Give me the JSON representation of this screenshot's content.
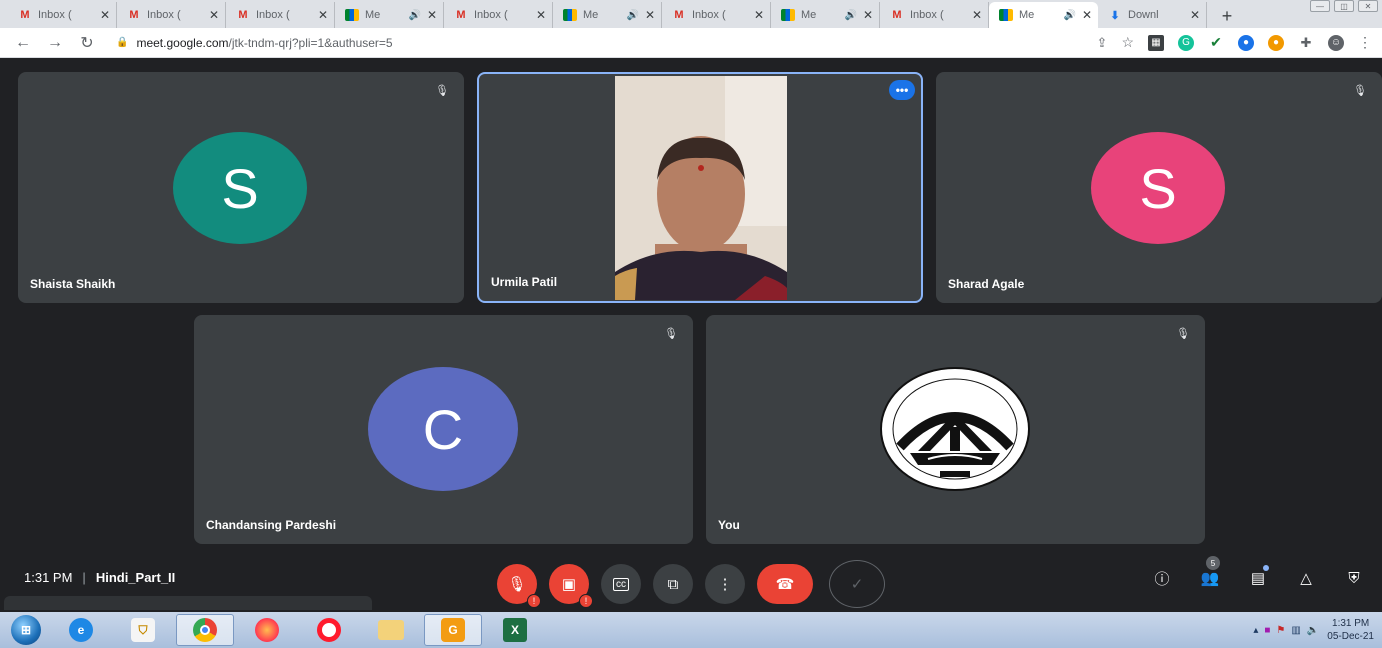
{
  "browser": {
    "tabs": [
      {
        "title": "Inbox (",
        "favicon": "gmail-icon",
        "active": false
      },
      {
        "title": "Inbox (",
        "favicon": "gmail-icon",
        "active": false
      },
      {
        "title": "Inbox (",
        "favicon": "gmail-icon",
        "active": false
      },
      {
        "title": "Me",
        "favicon": "meet-icon",
        "active": false,
        "audio": true
      },
      {
        "title": "Inbox (",
        "favicon": "gmail-icon",
        "active": false
      },
      {
        "title": "Me",
        "favicon": "meet-icon",
        "active": false,
        "audio": true
      },
      {
        "title": "Inbox (",
        "favicon": "gmail-icon",
        "active": false
      },
      {
        "title": "Me",
        "favicon": "meet-icon",
        "active": false,
        "audio": true
      },
      {
        "title": "Inbox (",
        "favicon": "gmail-icon",
        "active": false
      },
      {
        "title": "Me",
        "favicon": "meet-icon",
        "active": true,
        "audio": true
      },
      {
        "title": "Downl",
        "favicon": "download-icon",
        "active": false
      }
    ],
    "url_host": "meet.google.com",
    "url_path": "/jtk-tndm-qrj?pli=1&authuser=5"
  },
  "participants": [
    {
      "name": "Shaista Shaikh",
      "initial": "S",
      "color": "#128c7e"
    },
    {
      "name": "Urmila Patil",
      "video": true
    },
    {
      "name": "Sharad Agale",
      "initial": "S",
      "color": "#e8437a"
    },
    {
      "name": "Chandansing Pardeshi",
      "initial": "C",
      "color": "#5c6bc0"
    },
    {
      "name": "You",
      "logo": true
    }
  ],
  "meeting": {
    "time": "1:31 PM",
    "separator": "|",
    "code": "Hindi_Part_II",
    "participant_count": "5"
  },
  "taskbar": {
    "clock_time": "1:31 PM",
    "clock_date": "05-Dec-21"
  },
  "colors": {
    "meet_bg": "#202124",
    "tile_bg": "#3c4043",
    "danger": "#ea4335",
    "accent": "#1a73e8"
  }
}
